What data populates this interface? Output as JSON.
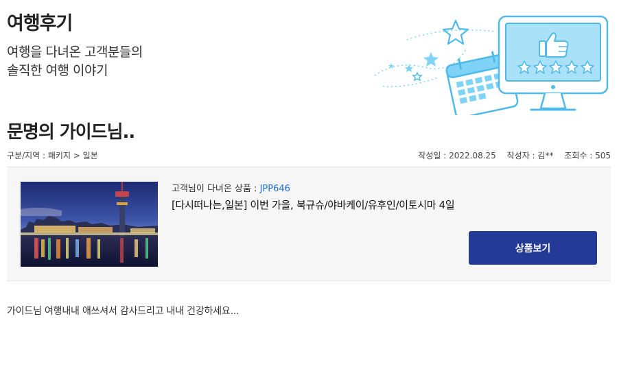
{
  "hero": {
    "title": "여행후기",
    "subtitle_line1": "여행을 다녀온 고객분들의",
    "subtitle_line2": "솔직한 여행 이야기"
  },
  "post": {
    "title": "문명의 가이드님..",
    "category": "구분/지역 : 패키지 > 일본",
    "date": "작성일 : 2022.08.25",
    "author": "작성자 : 김**",
    "views": "조회수 : 505",
    "body": "가이드님 여행내내 애쓰셔서 감사드리고  내내 건강하세요..."
  },
  "product": {
    "label": "고객님이 다녀온 상품 : ",
    "code": "JPP646",
    "name": "[다시떠나는,일본] 이번 가을, 북규슈/야바케이/유후인/이토시마 4일",
    "button_label": "상품보기"
  },
  "colors": {
    "button_bg": "#233a96",
    "code_link": "#1a6fd6",
    "illustration_blue": "#5bc6f0"
  }
}
